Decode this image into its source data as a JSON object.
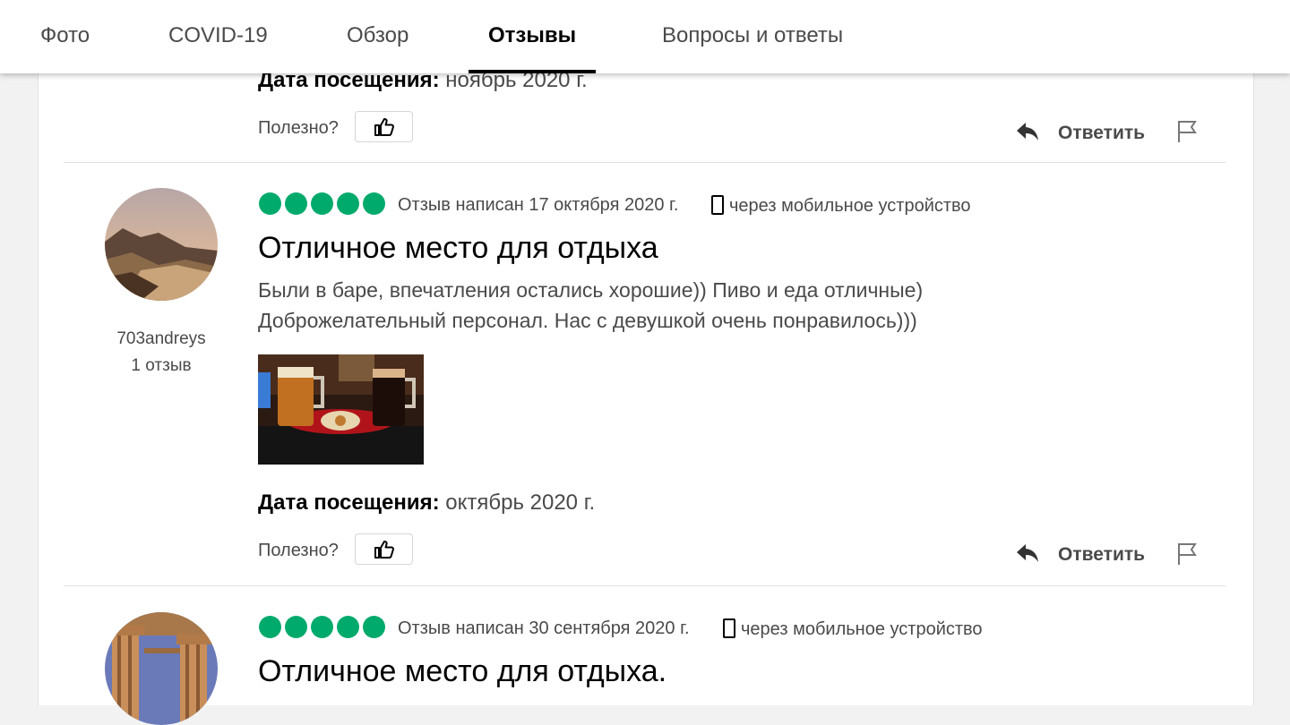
{
  "nav": {
    "tabs": [
      {
        "label": "Фото"
      },
      {
        "label": "COVID-19"
      },
      {
        "label": "Обзор"
      },
      {
        "label": "Отзывы",
        "active": true
      },
      {
        "label": "Вопросы и ответы"
      }
    ]
  },
  "prev_review": {
    "visit_label": "Дата посещения:",
    "visit_value": "ноябрь 2020 г.",
    "helpful": "Полезно?",
    "reply": "Ответить"
  },
  "reviews": [
    {
      "rating": 5,
      "written": "Отзыв написан 17 октября 2020 г.",
      "device": "через мобильное устройство",
      "title": "Отличное место для отдыха",
      "text_lines": [
        "Были в баре, впечатления остались хорошие)) Пиво и еда отличные)",
        "Доброжелательный персонал. Нас с девушкой очень понравилось)))"
      ],
      "user": {
        "name": "703andreys",
        "count": "1 отзыв"
      },
      "visit_label": "Дата посещения:",
      "visit_value": "октябрь 2020 г.",
      "helpful": "Полезно?",
      "reply": "Ответить"
    },
    {
      "rating": 5,
      "written": "Отзыв написан 30 сентября 2020 г.",
      "device": "через мобильное устройство",
      "title": "Отличное место для отдыха."
    }
  ],
  "colors": {
    "bubble": "#00aa6c",
    "text_secondary": "#4a4a4a"
  },
  "icons": [
    "thumbs-up-icon",
    "reply-arrow-icon",
    "flag-icon",
    "mobile-phone-icon"
  ]
}
